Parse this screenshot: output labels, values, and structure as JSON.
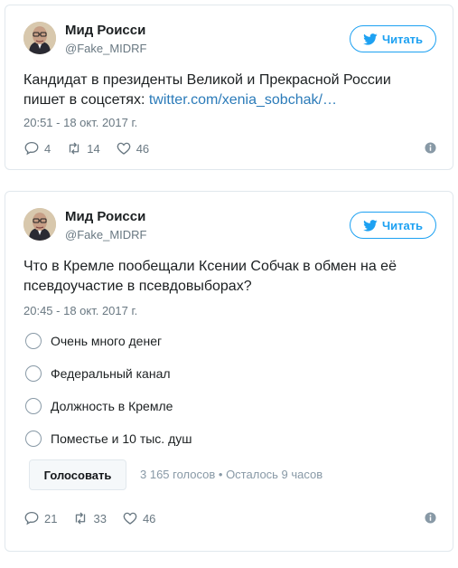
{
  "tweets": [
    {
      "author_name": "Мид Роисси",
      "author_handle": "@Fake_MIDRF",
      "follow_label": "Читать",
      "text": "Кандидат в президенты Великой и Прекрасной России пишет в соцсетях: ",
      "link": "twitter.com/xenia_sobchak/…",
      "timestamp": "20:51 - 18 окт. 2017 г.",
      "replies": "4",
      "retweets": "14",
      "likes": "46"
    },
    {
      "author_name": "Мид Роисси",
      "author_handle": "@Fake_MIDRF",
      "follow_label": "Читать",
      "text": "Что в Кремле пообещали Ксении Собчак в обмен на её псевдоучастие в псевдовыборах?",
      "timestamp": "20:45 - 18 окт. 2017 г.",
      "poll": {
        "options": [
          "Очень много денег",
          "Федеральный канал",
          "Должность в Кремле",
          "Поместье и 10 тыс. душ"
        ],
        "vote_label": "Голосовать",
        "meta": "3 165 голосов • Осталось 9 часов"
      },
      "replies": "21",
      "retweets": "33",
      "likes": "46"
    }
  ],
  "colors": {
    "accent": "#1da1f2",
    "link": "#2b7bb9",
    "muted": "#697882",
    "border": "#e1e8ed"
  },
  "icons": [
    "avatar",
    "twitter-bird-icon",
    "reply-icon",
    "retweet-icon",
    "heart-icon",
    "info-icon"
  ]
}
